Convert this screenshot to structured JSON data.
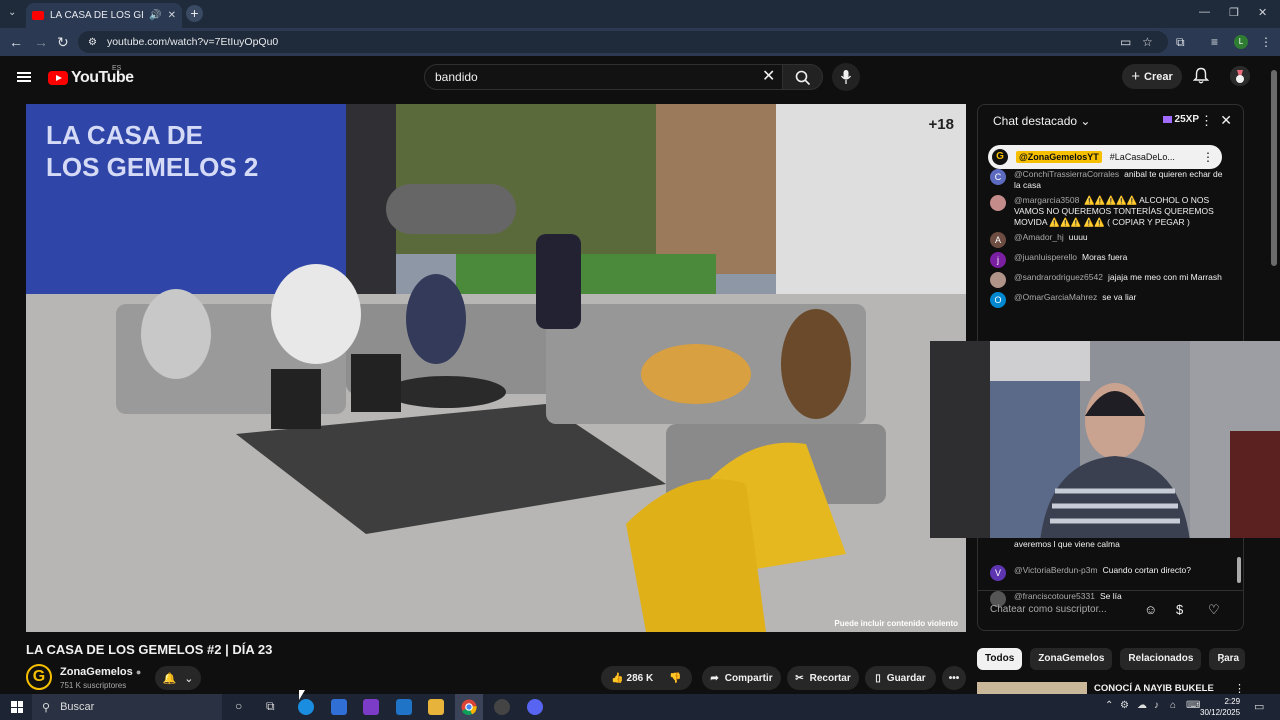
{
  "browser": {
    "tab_title": "LA CASA DE LOS GEMELOS",
    "new_tab_symbol": "+",
    "url": "youtube.com/watch?v=7EtIuyOpQu0",
    "profile_initial": "L"
  },
  "header": {
    "logo_text": "YouTube",
    "logo_region": "ES",
    "search_value": "bandido",
    "create_label": "Crear"
  },
  "player": {
    "rating": "+18",
    "warning": "Puede incluir contenido violento"
  },
  "chat": {
    "title": "Chat destacado",
    "xp": "25XP",
    "pinned_author": "@ZonaGemelosYT",
    "pinned_text": "#LaCasaDeLo...",
    "messages": [
      {
        "avatar": "C",
        "color": "#5c6bc0",
        "name": "@ConchiTrassierraCorrales",
        "text": "anibal te quieren echar de la casa"
      },
      {
        "avatar": "",
        "color": "#c48b8b",
        "name": "@margarcia3508",
        "text": "⚠️⚠️⚠️⚠️⚠️ ALCOHOL O NOS VAMOS NO QUEREMOS TONTERÍAS QUEREMOS MOVIDA ⚠️⚠️⚠️ ⚠️⚠️ ( COPIAR Y PEGAR )"
      },
      {
        "avatar": "A",
        "color": "#6d4c41",
        "name": "@Amador_hj",
        "text": "uuuu"
      },
      {
        "avatar": "j",
        "color": "#7b1fa2",
        "name": "@juanluisperello",
        "text": "Moras fuera"
      },
      {
        "avatar": "",
        "color": "#b0948a",
        "name": "@sandrarodriguez6542",
        "text": "jajaja me meo con mi Marrash"
      },
      {
        "avatar": "O",
        "color": "#0288d1",
        "name": "@OmarGarciaMahrez",
        "text": "se va liar"
      }
    ],
    "lower_messages": [
      {
        "avatar": "",
        "color": "#000000",
        "name": "",
        "text": "averemos l que viene calma"
      },
      {
        "avatar": "V",
        "color": "#5e35b1",
        "name": "@VictoriaBerdun-p3m",
        "text": "Cuando cortan directo?"
      },
      {
        "avatar": "",
        "color": "#555555",
        "name": "@franciscotoure5331",
        "text": "Se lía"
      }
    ],
    "input_placeholder": "Chatear como suscriptor..."
  },
  "video": {
    "title": "LA CASA DE LOS GEMELOS #2 | DÍA 23",
    "channel_name": "ZonaGemelos",
    "channel_initial": "G",
    "subscribers": "751 K suscriptores",
    "likes": "286 K",
    "share_label": "Compartir",
    "clip_label": "Recortar",
    "save_label": "Guardar"
  },
  "related": {
    "chips": [
      "Todos",
      "ZonaGemelos",
      "Relacionados",
      "Para"
    ],
    "first_title": "CONOCÍ A NAYIB BUKELE"
  },
  "taskbar": {
    "search_placeholder": "Buscar",
    "time": "2:29",
    "date": "30/12/2025"
  },
  "colors": {
    "youtube_red": "#ff0000",
    "owner_badge": "#f6c000",
    "xp_gem": "#a26bff"
  }
}
